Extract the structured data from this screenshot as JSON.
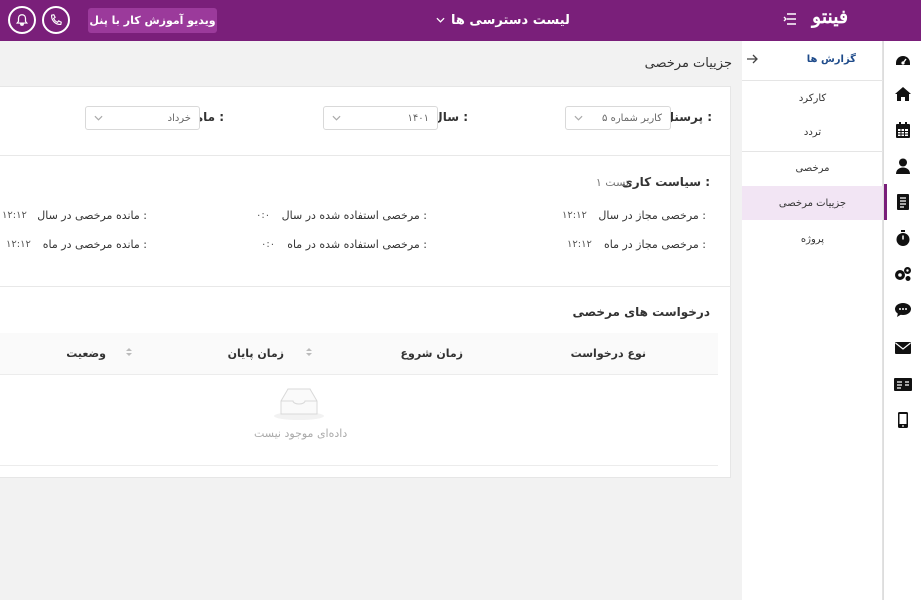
{
  "topbar": {
    "video_button_label": "ویدیو آموزش کار با پنل",
    "access_list_label": "لیست دسترسی ها",
    "logo_text": "فینتو",
    "background_color": "#7a1f7a"
  },
  "submenu": {
    "header_title": "گزارش ها",
    "items": [
      {
        "label": "کارکرد"
      },
      {
        "label": "تردد"
      },
      {
        "label": "مرخصی"
      },
      {
        "label": "جزییات مرخصی"
      },
      {
        "label": "پروژه"
      }
    ],
    "active_index": 3
  },
  "rail_icons": [
    "dashboard-icon",
    "home-icon",
    "calendar-icon",
    "user-icon",
    "document-icon",
    "stopwatch-icon",
    "settings-icon",
    "chat-icon",
    "mail-icon",
    "id-card-icon",
    "mobile-icon"
  ],
  "page": {
    "title": "جزییات مرخصی"
  },
  "filters": {
    "personnel_label": "پرسنل :",
    "personnel_value": "کاربر شماره ۵",
    "year_label": "سال :",
    "year_value": "۱۴۰۱",
    "month_label": "ماه :",
    "month_value": "خرداد"
  },
  "policy": {
    "title": "سیاست کاری :",
    "value": "تست ۱",
    "allowed_year_label": "مرخصی مجاز در سال :",
    "allowed_year_value": "۱۲:۱۲",
    "used_year_label": "مرخصی استفاده شده در سال :",
    "used_year_value": "۰:۰",
    "remaining_year_label": "مانده مرخصی در سال :",
    "remaining_year_value": "۱۲:۱۲",
    "allowed_month_label": "مرخصی مجاز در ماه :",
    "allowed_month_value": "۱۲:۱۲",
    "used_month_label": "مرخصی استفاده شده در ماه :",
    "used_month_value": "۰:۰",
    "remaining_month_label": "مانده مرخصی در ماه :",
    "remaining_month_value": "۱۲:۱۲"
  },
  "requests": {
    "title": "درخواست های مرخصی",
    "columns": [
      "نوع درخواست",
      "زمان شروع",
      "زمان پایان",
      "وضعیت"
    ],
    "empty_text": "داده‌ای موجود نیست"
  }
}
